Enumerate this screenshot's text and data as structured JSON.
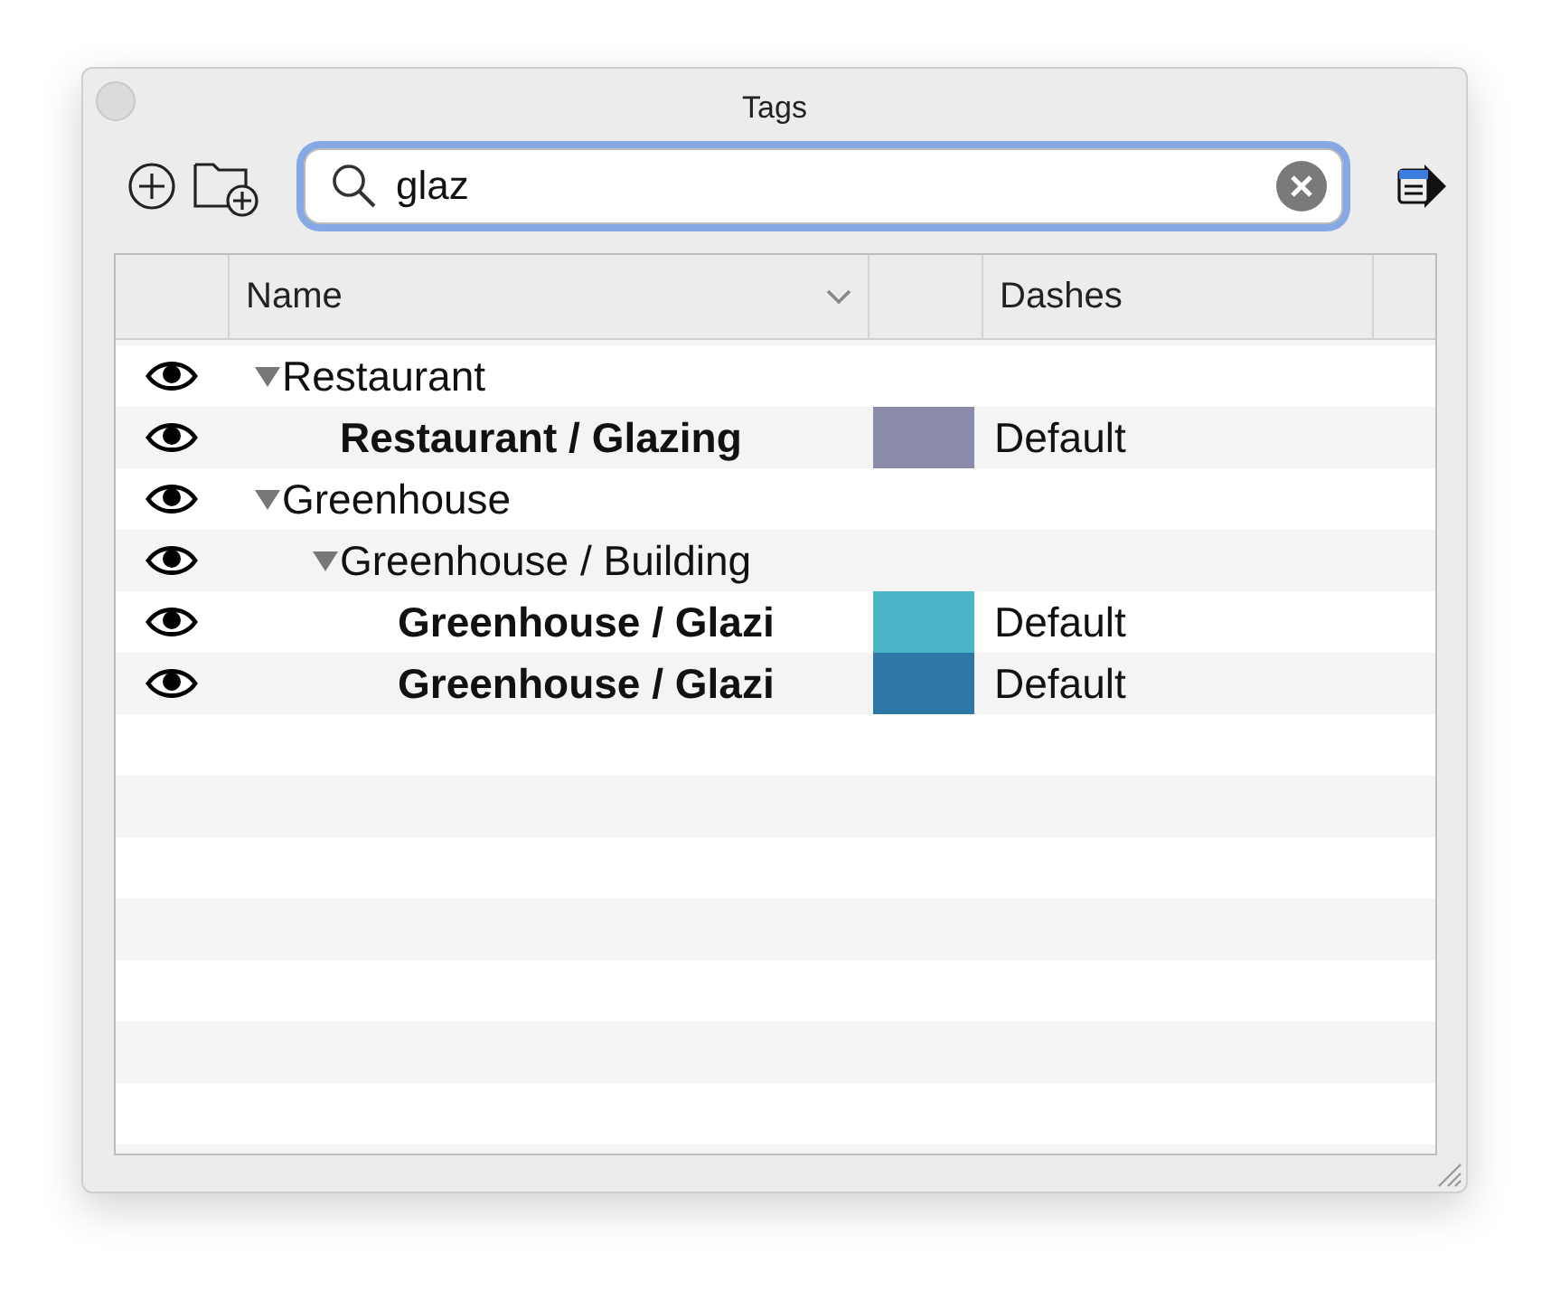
{
  "window": {
    "title": "Tags"
  },
  "search": {
    "value": "glaz"
  },
  "table": {
    "columns": [
      "Name",
      "Dashes"
    ],
    "rows": [
      {
        "name": "Restaurant",
        "visible": true,
        "expanded": true,
        "children": [
          {
            "name": "Restaurant / Glazing",
            "visible": true,
            "color": "#8a8ba8",
            "dashes": "Default"
          }
        ]
      },
      {
        "name": "Greenhouse",
        "visible": true,
        "expanded": true,
        "children": [
          {
            "name": "Greenhouse / Building",
            "visible": true,
            "expanded": true,
            "children": [
              {
                "name": "Greenhouse / Glazi",
                "visible": true,
                "color": "#4ab5c4",
                "dashes": "Default"
              },
              {
                "name": "Greenhouse / Glazi",
                "visible": true,
                "color": "#2e78a6",
                "dashes": "Default"
              }
            ]
          }
        ]
      }
    ]
  }
}
